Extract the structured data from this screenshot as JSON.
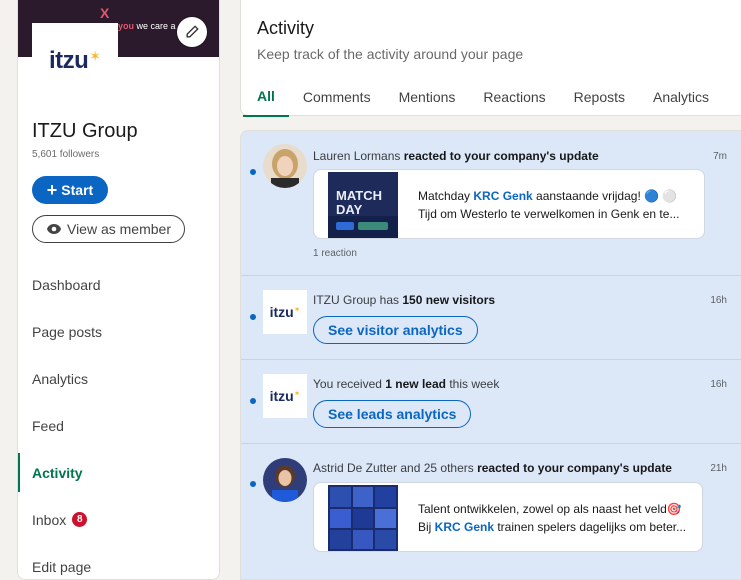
{
  "brand": {
    "logo_word": "itzu",
    "logo_star": "✶",
    "cover_tagline_accent": "you",
    "cover_tagline": " we care a",
    "cover_x": "X"
  },
  "sidebar": {
    "company_name": "ITZU Group",
    "followers": "5,601 followers",
    "start_label": "Start",
    "start_icon": "+",
    "view_as_member_label": "View as member",
    "nav": [
      {
        "label": "Dashboard",
        "active": false
      },
      {
        "label": "Page posts",
        "active": false
      },
      {
        "label": "Analytics",
        "active": false
      },
      {
        "label": "Feed",
        "active": false
      },
      {
        "label": "Activity",
        "active": true
      },
      {
        "label": "Inbox",
        "active": false,
        "badge": "8"
      },
      {
        "label": "Edit page",
        "active": false
      }
    ]
  },
  "header": {
    "title": "Activity",
    "subtitle": "Keep track of the activity around your page",
    "tabs": [
      {
        "label": "All",
        "active": true
      },
      {
        "label": "Comments",
        "active": false
      },
      {
        "label": "Mentions",
        "active": false
      },
      {
        "label": "Reactions",
        "active": false
      },
      {
        "label": "Reposts",
        "active": false
      },
      {
        "label": "Analytics",
        "active": false
      }
    ]
  },
  "feed": [
    {
      "actor": "Lauren Lormans",
      "action": " reacted to your company's update",
      "time": "7m",
      "post_line1_prefix": "Matchday ",
      "post_line1_link": "KRC Genk",
      "post_line1_suffix": " aanstaande vrijdag! 🔵 ⚪",
      "post_line2": "Tijd om Westerlo te verwelkomen in Genk en te...",
      "thumb_title_1": "MATCH",
      "thumb_title_2": "DAY",
      "reactions": "1 reaction"
    },
    {
      "prefix": "ITZU Group has ",
      "bold": "150 new visitors",
      "suffix": "",
      "time": "16h",
      "button": "See visitor analytics"
    },
    {
      "prefix": "You received ",
      "bold": "1 new lead",
      "suffix": " this week",
      "time": "16h",
      "button": "See leads analytics"
    },
    {
      "actor": "Astrid De Zutter and 25 others",
      "action": " reacted to your company's update",
      "time": "21h",
      "post_line1": "Talent ontwikkelen, zowel op als naast het veld🎯",
      "post_line2_prefix": "Bij ",
      "post_line2_link": "KRC Genk",
      "post_line2_suffix": " trainen spelers dagelijks om beter..."
    }
  ],
  "colors": {
    "accent": "#0a66c2",
    "active_green": "#01754f",
    "unread_bg": "#dce8f7",
    "badge_red": "#cb112d",
    "logo_navy": "#1a2a5e",
    "logo_gold": "#f5b62a"
  }
}
